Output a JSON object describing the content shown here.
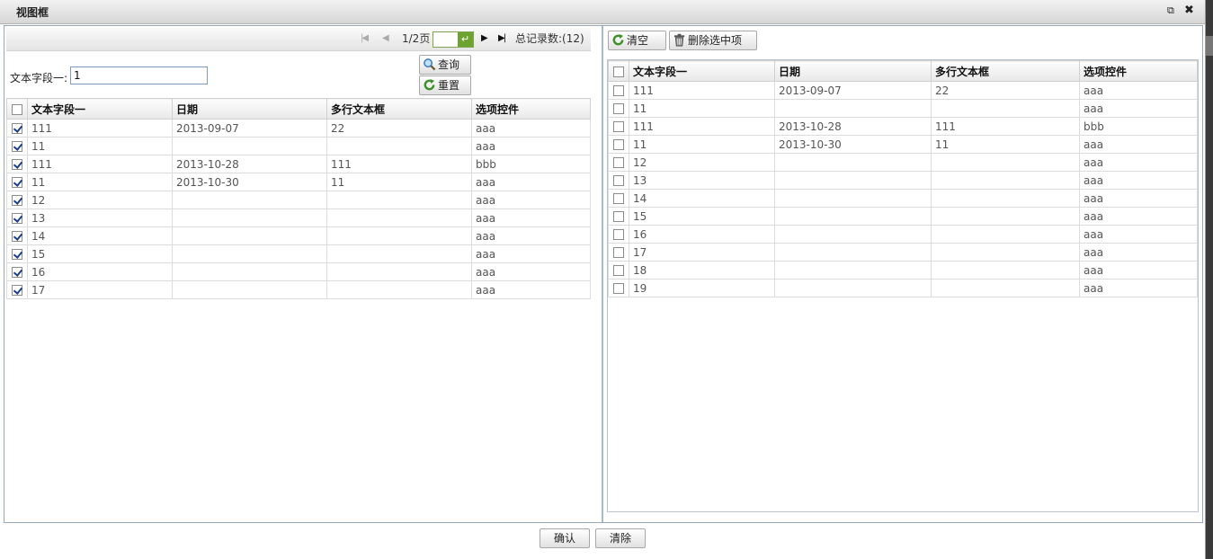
{
  "dialog": {
    "title": "视图框",
    "restore_icon": "restore-icon",
    "close_icon": "close-icon"
  },
  "left": {
    "pager": {
      "first_icon": "first-page-icon",
      "prev_icon": "prev-page-icon",
      "page_text": "1/2页",
      "page_input_value": "",
      "go_icon": "enter-icon",
      "next_icon": "next-page-icon",
      "last_icon": "last-page-icon",
      "total_text": "总记录数:(12)"
    },
    "search": {
      "label": "文本字段一:",
      "value": "1",
      "query_label": "查询",
      "reset_label": "重置"
    },
    "columns": [
      "文本字段一",
      "日期",
      "多行文本框",
      "选项控件"
    ],
    "rows": [
      {
        "checked": true,
        "c1": "111",
        "c2": "2013-09-07",
        "c3": "22",
        "c4": "aaa"
      },
      {
        "checked": true,
        "c1": "11",
        "c2": "",
        "c3": "",
        "c4": "aaa"
      },
      {
        "checked": true,
        "c1": "111",
        "c2": "2013-10-28",
        "c3": "111",
        "c4": "bbb"
      },
      {
        "checked": true,
        "c1": "11",
        "c2": "2013-10-30",
        "c3": "11",
        "c4": "aaa"
      },
      {
        "checked": true,
        "c1": "12",
        "c2": "",
        "c3": "",
        "c4": "aaa"
      },
      {
        "checked": true,
        "c1": "13",
        "c2": "",
        "c3": "",
        "c4": "aaa"
      },
      {
        "checked": true,
        "c1": "14",
        "c2": "",
        "c3": "",
        "c4": "aaa"
      },
      {
        "checked": true,
        "c1": "15",
        "c2": "",
        "c3": "",
        "c4": "aaa"
      },
      {
        "checked": true,
        "c1": "16",
        "c2": "",
        "c3": "",
        "c4": "aaa"
      },
      {
        "checked": true,
        "c1": "17",
        "c2": "",
        "c3": "",
        "c4": "aaa"
      }
    ]
  },
  "right": {
    "clear_label": "清空",
    "delete_label": "删除选中项",
    "columns": [
      "文本字段一",
      "日期",
      "多行文本框",
      "选项控件"
    ],
    "rows": [
      {
        "checked": false,
        "c1": "111",
        "c2": "2013-09-07",
        "c3": "22",
        "c4": "aaa"
      },
      {
        "checked": false,
        "c1": "11",
        "c2": "",
        "c3": "",
        "c4": "aaa"
      },
      {
        "checked": false,
        "c1": "111",
        "c2": "2013-10-28",
        "c3": "111",
        "c4": "bbb"
      },
      {
        "checked": false,
        "c1": "11",
        "c2": "2013-10-30",
        "c3": "11",
        "c4": "aaa"
      },
      {
        "checked": false,
        "c1": "12",
        "c2": "",
        "c3": "",
        "c4": "aaa"
      },
      {
        "checked": false,
        "c1": "13",
        "c2": "",
        "c3": "",
        "c4": "aaa"
      },
      {
        "checked": false,
        "c1": "14",
        "c2": "",
        "c3": "",
        "c4": "aaa"
      },
      {
        "checked": false,
        "c1": "15",
        "c2": "",
        "c3": "",
        "c4": "aaa"
      },
      {
        "checked": false,
        "c1": "16",
        "c2": "",
        "c3": "",
        "c4": "aaa"
      },
      {
        "checked": false,
        "c1": "17",
        "c2": "",
        "c3": "",
        "c4": "aaa"
      },
      {
        "checked": false,
        "c1": "18",
        "c2": "",
        "c3": "",
        "c4": "aaa"
      },
      {
        "checked": false,
        "c1": "19",
        "c2": "",
        "c3": "",
        "c4": "aaa"
      }
    ]
  },
  "footer": {
    "confirm_label": "确认",
    "cancel_label": "清除"
  },
  "colors": {
    "titlebar": "#dcdcdc",
    "pager_go": "#6da331",
    "check": "#1a3f8a",
    "refresh_icon": "#3f8f2a"
  }
}
